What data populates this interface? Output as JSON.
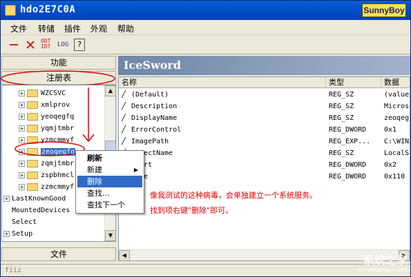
{
  "window": {
    "title": "hdo2E7C0A",
    "brand": "SunnyBoy"
  },
  "menu": [
    "文件",
    "转储",
    "插件",
    "外观",
    "帮助"
  ],
  "toolbar": {
    "btn3": "ODT\nIDT",
    "btn4": "LOG",
    "btn5": "?"
  },
  "left": {
    "header_function": "功能",
    "header_registry": "注册表",
    "footer": "文件",
    "tree": [
      {
        "label": "WZCSVC",
        "exp": "+"
      },
      {
        "label": "xmlprov",
        "exp": "+"
      },
      {
        "label": "yeoqegfq",
        "exp": "+"
      },
      {
        "label": "yqmjtmbr",
        "exp": "+"
      },
      {
        "label": "yzmcmmyf",
        "exp": "+"
      },
      {
        "label": "zeoqegfq",
        "exp": "+",
        "selected": true
      },
      {
        "label": "zqmjtmbr",
        "exp": "+"
      },
      {
        "label": "zspbhmcl",
        "exp": "+"
      },
      {
        "label": "zzmcmmyf",
        "exp": "+"
      }
    ],
    "tree_root": [
      {
        "label": "LastKnownGood",
        "exp": "+"
      },
      {
        "label": "MountedDevices",
        "exp": ""
      },
      {
        "label": "Select",
        "exp": ""
      },
      {
        "label": "Setup",
        "exp": "+"
      }
    ]
  },
  "right": {
    "header": "IceSword",
    "columns": [
      "名称",
      "类型",
      "数据"
    ],
    "rows": [
      {
        "name": "(Default)",
        "type": "REG_SZ",
        "data": "(value"
      },
      {
        "name": "Description",
        "type": "REG_SZ",
        "data": "Micros"
      },
      {
        "name": "DisplayName",
        "type": "REG_SZ",
        "data": "zeoqeg"
      },
      {
        "name": "ErrorControl",
        "type": "REG_DWORD",
        "data": "0x1"
      },
      {
        "name": "ImagePath",
        "type": "REG_EXP...",
        "data": "C:\\WIN"
      },
      {
        "name": "ObjectName",
        "type": "REG_SZ",
        "data": "LocalS"
      },
      {
        "name": "Start",
        "type": "REG_DWORD",
        "data": "0x2"
      },
      {
        "name": "Type",
        "type": "REG_DWORD",
        "data": "0x110"
      }
    ]
  },
  "context_menu": {
    "items": [
      "刷新",
      "新建",
      "删除",
      "查找...",
      "查找下一个"
    ]
  },
  "annotations": {
    "line1": "像我测试的这种病毒，会单独建立一个系统服务。",
    "line2": "找到项右键\"删除\"即可。"
  },
  "status": "fiiz",
  "watermark": {
    "text": "系统之家",
    "sub": "XITONGZHIJIA.NET"
  }
}
